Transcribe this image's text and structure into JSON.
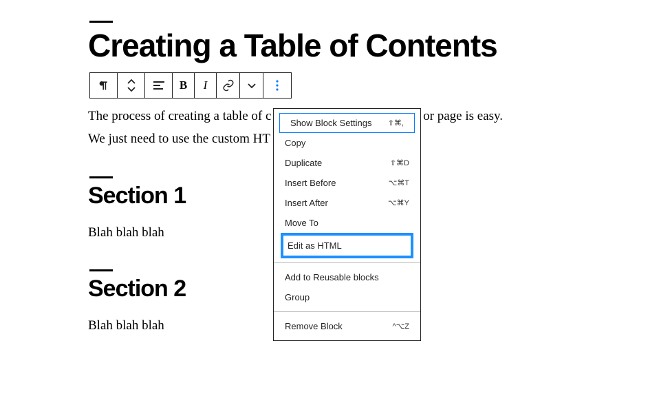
{
  "page": {
    "title": "Creating a Table of Contents",
    "p1a": "The process of creating a table of c",
    "p1b": " or page is easy.",
    "p2": "We just need to use the custom HT",
    "sec1": "Section 1",
    "sec1_body": "Blah blah blah",
    "sec2": "Section 2",
    "sec2_body": "Blah blah blah"
  },
  "toolbar": {
    "bold": "B",
    "italic": "I"
  },
  "dropdown": {
    "show_settings": {
      "label": "Show Block Settings",
      "shortcut": "⇧⌘,"
    },
    "copy": {
      "label": "Copy"
    },
    "duplicate": {
      "label": "Duplicate",
      "shortcut": "⇧⌘D"
    },
    "insert_before": {
      "label": "Insert Before",
      "shortcut": "⌥⌘T"
    },
    "insert_after": {
      "label": "Insert After",
      "shortcut": "⌥⌘Y"
    },
    "move_to": {
      "label": "Move To"
    },
    "edit_html": {
      "label": "Edit as HTML"
    },
    "reusable": {
      "label": "Add to Reusable blocks"
    },
    "group": {
      "label": "Group"
    },
    "remove": {
      "label": "Remove Block",
      "shortcut": "^⌥Z"
    }
  }
}
